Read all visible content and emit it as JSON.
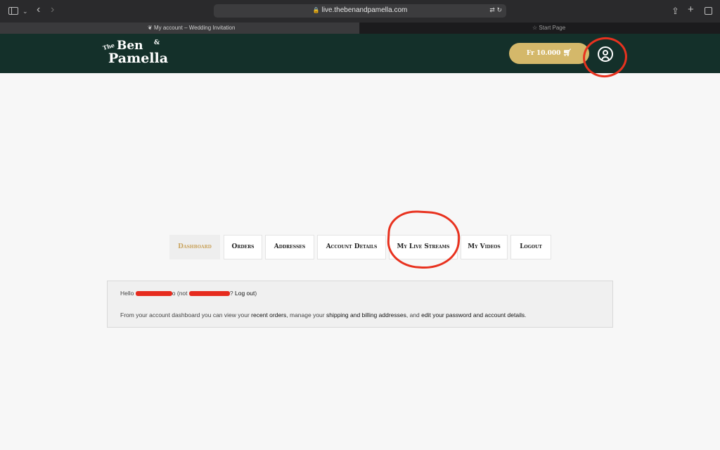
{
  "browser": {
    "url": "live.thebenandpamella.com",
    "tabs": [
      {
        "label": "My account – Wedding Invitation",
        "active": true
      },
      {
        "label": "Start Page",
        "active": false
      }
    ]
  },
  "header": {
    "logo": {
      "the": "The",
      "ben": "Ben",
      "amp": "&",
      "pamella": "Pamella"
    },
    "cart_label": "Fr 10.000",
    "cart_icon": "cart-icon",
    "account_icon": "user-circle-icon",
    "brand_color": "#14302a",
    "accent_color": "#d4b86a"
  },
  "account_nav": {
    "items": [
      {
        "label": "Dashboard",
        "active": true
      },
      {
        "label": "Orders",
        "active": false
      },
      {
        "label": "Addresses",
        "active": false
      },
      {
        "label": "Account Details",
        "active": false
      },
      {
        "label": "My Live Streams",
        "active": false
      },
      {
        "label": "My Videos",
        "active": false
      },
      {
        "label": "Logout",
        "active": false
      }
    ]
  },
  "dashboard": {
    "hello_prefix": "Hello",
    "hello_name_tail": "o",
    "not_prefix": "(not",
    "logout_link": "Log out",
    "logout_suffix": ")",
    "question": "?",
    "desc_1": "From your account dashboard you can view your",
    "recent_orders": "recent orders",
    "desc_2": ", manage your",
    "addresses_link": "shipping and billing addresses",
    "desc_3": ", and",
    "account_link": "edit your password and account details",
    "desc_4": "."
  }
}
